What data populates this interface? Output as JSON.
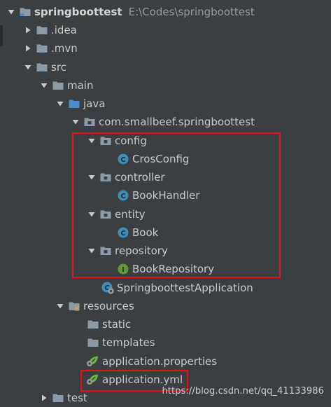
{
  "project": {
    "name": "springboottest",
    "path": "E:\\Codes\\springboottest"
  },
  "tree": {
    "idea": ".idea",
    "mvn": ".mvn",
    "src": "src",
    "main": "main",
    "java": "java",
    "package": "com.smallbeef.springboottest",
    "config": "config",
    "cros_config": "CrosConfig",
    "controller": "controller",
    "book_handler": "BookHandler",
    "entity": "entity",
    "book": "Book",
    "repository": "repository",
    "book_repository": "BookRepository",
    "application_class": "SpringboottestApplication",
    "resources": "resources",
    "static": "static",
    "templates": "templates",
    "application_properties": "application.properties",
    "application_yml": "application.yml",
    "test": "test"
  },
  "icon_letters": {
    "class": "C",
    "interface": "I"
  },
  "watermark": "https://blog.csdn.net/qq_41133986",
  "colors": {
    "background": "#3c3f41",
    "text": "#cacaca",
    "path_text": "#9a9a9a",
    "folder": "#8b9aa6",
    "source_folder": "#4b8ccc",
    "class_icon": "#3d8fb8",
    "interface_icon": "#5f9c39",
    "spring_leaf": "#6db33f",
    "highlight_box": "#e8111a"
  }
}
